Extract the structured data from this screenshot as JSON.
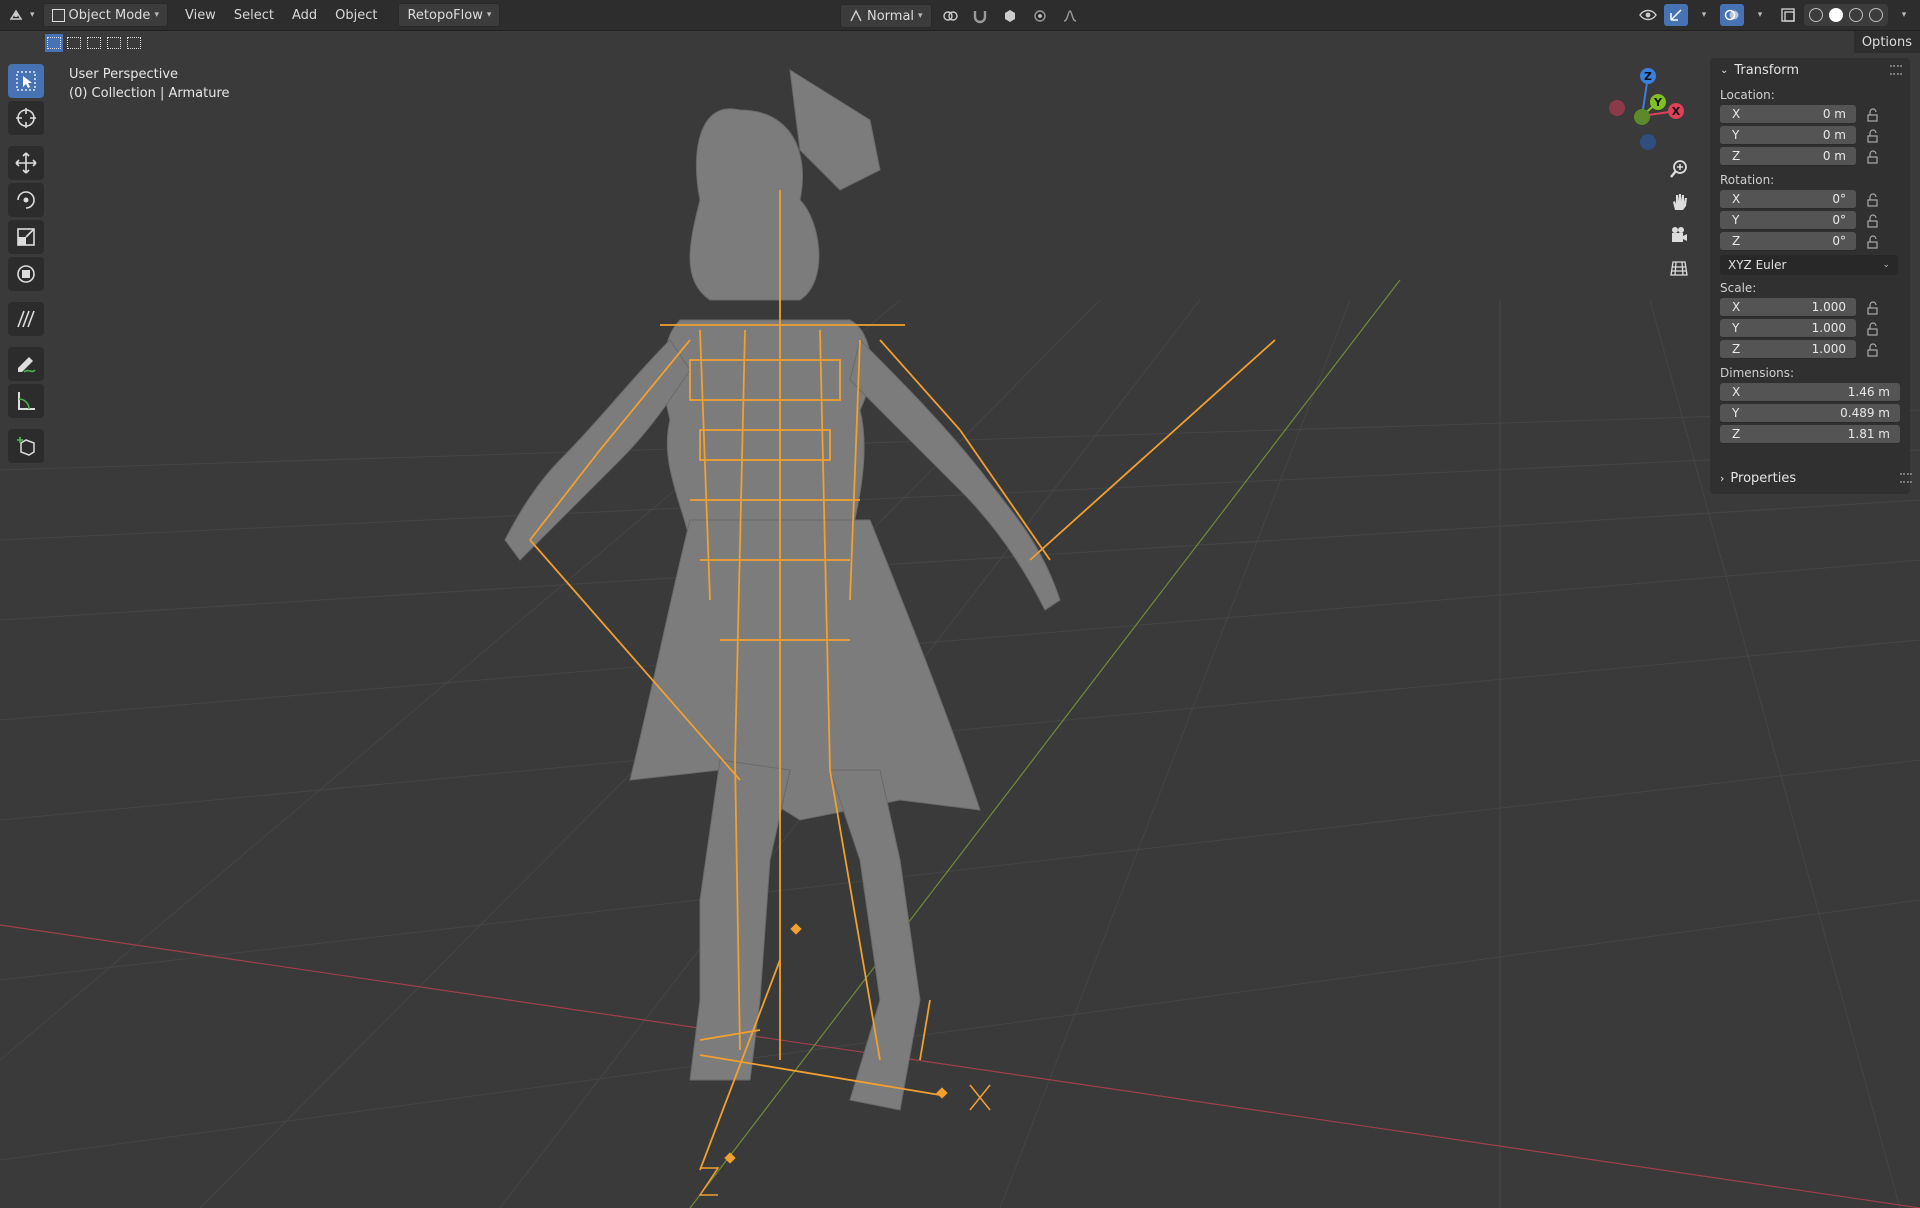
{
  "header": {
    "mode": "Object Mode",
    "menus": [
      "View",
      "Select",
      "Add",
      "Object"
    ],
    "addon": "RetopoFlow",
    "orientation": "Normal"
  },
  "options_label": "Options",
  "viewport": {
    "perspective": "User Perspective",
    "collection": "(0) Collection | Armature"
  },
  "gizmo": {
    "z": "Z",
    "y": "Y",
    "x": "X"
  },
  "transform": {
    "title": "Transform",
    "location_label": "Location:",
    "location": [
      {
        "axis": "X",
        "value": "0 m"
      },
      {
        "axis": "Y",
        "value": "0 m"
      },
      {
        "axis": "Z",
        "value": "0 m"
      }
    ],
    "rotation_label": "Rotation:",
    "rotation": [
      {
        "axis": "X",
        "value": "0°"
      },
      {
        "axis": "Y",
        "value": "0°"
      },
      {
        "axis": "Z",
        "value": "0°"
      }
    ],
    "rotation_mode": "XYZ Euler",
    "scale_label": "Scale:",
    "scale": [
      {
        "axis": "X",
        "value": "1.000"
      },
      {
        "axis": "Y",
        "value": "1.000"
      },
      {
        "axis": "Z",
        "value": "1.000"
      }
    ],
    "dimensions_label": "Dimensions:",
    "dimensions": [
      {
        "axis": "X",
        "value": "1.46 m"
      },
      {
        "axis": "Y",
        "value": "0.489 m"
      },
      {
        "axis": "Z",
        "value": "1.81 m"
      }
    ]
  },
  "properties_title": "Properties",
  "colors": {
    "accent": "#4772b3",
    "armature": "#f0a030",
    "x_axis": "#e0405a",
    "y_axis": "#80c020",
    "z_axis": "#3a80e0",
    "mesh": "#7a7a7a"
  }
}
